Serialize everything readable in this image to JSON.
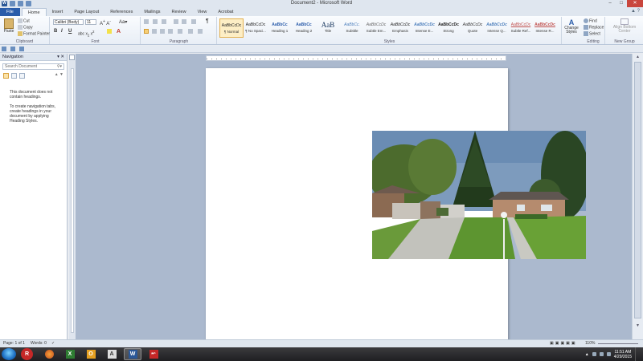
{
  "window": {
    "title": "Document2 - Microsoft Word",
    "controls": [
      "minimize",
      "maximize",
      "close"
    ]
  },
  "ribbon_tabs": [
    "File",
    "Home",
    "Insert",
    "Page Layout",
    "References",
    "Mailings",
    "Review",
    "View",
    "Acrobat"
  ],
  "active_tab": "Home",
  "clipboard": {
    "paste": "Paste",
    "cut": "Cut",
    "copy": "Copy",
    "format_painter": "Format Painter",
    "label": "Clipboard"
  },
  "font": {
    "name": "Calibri (Body)",
    "size": "11",
    "label": "Font",
    "bold": "B",
    "italic": "I",
    "underline": "U"
  },
  "paragraph": {
    "label": "Paragraph",
    "show_marks": "¶"
  },
  "styles": {
    "label": "Styles",
    "items": [
      {
        "preview": "AaBbCcDc",
        "name": "¶ Normal",
        "active": true
      },
      {
        "preview": "AaBbCcDc",
        "name": "¶ No Spaci..."
      },
      {
        "preview": "AaBbCc",
        "name": "Heading 1"
      },
      {
        "preview": "AaBbCc",
        "name": "Heading 2"
      },
      {
        "preview": "AaB",
        "name": "Title"
      },
      {
        "preview": "AaBbCc.",
        "name": "Subtitle"
      },
      {
        "preview": "AaBbCcDc",
        "name": "Subtle Em..."
      },
      {
        "preview": "AaBbCcDc",
        "name": "Emphasis"
      },
      {
        "preview": "AaBbCcDc",
        "name": "Intense E..."
      },
      {
        "preview": "AaBbCcDc",
        "name": "Strong"
      },
      {
        "preview": "AaBbCcDc",
        "name": "Quote"
      },
      {
        "preview": "AaBbCcDc",
        "name": "Intense Q..."
      },
      {
        "preview": "AaBbCcDc",
        "name": "Subtle Ref..."
      },
      {
        "preview": "AaBbCcDc",
        "name": "Intense R..."
      }
    ],
    "change_styles": "Change Styles"
  },
  "editing": {
    "label": "Editing",
    "find": "Find",
    "replace": "Replace",
    "select": "Select"
  },
  "new_group": {
    "label": "New Group",
    "button": "Align Bottom Center"
  },
  "navigation": {
    "title": "Navigation",
    "search_placeholder": "Search Document",
    "message_1": "This document does not contain headings.",
    "message_2": "To create navigation tabs, create headings in your document by applying Heading Styles."
  },
  "status": {
    "page": "Page: 1 of 1",
    "words": "Words: 0",
    "zoom": "110%"
  },
  "taskbar": {
    "time": "11:51 AM",
    "date": "4/29/2015",
    "apps": [
      "R",
      "firefox",
      "excel",
      "outlook",
      "acrobat",
      "W",
      "pdf"
    ]
  }
}
